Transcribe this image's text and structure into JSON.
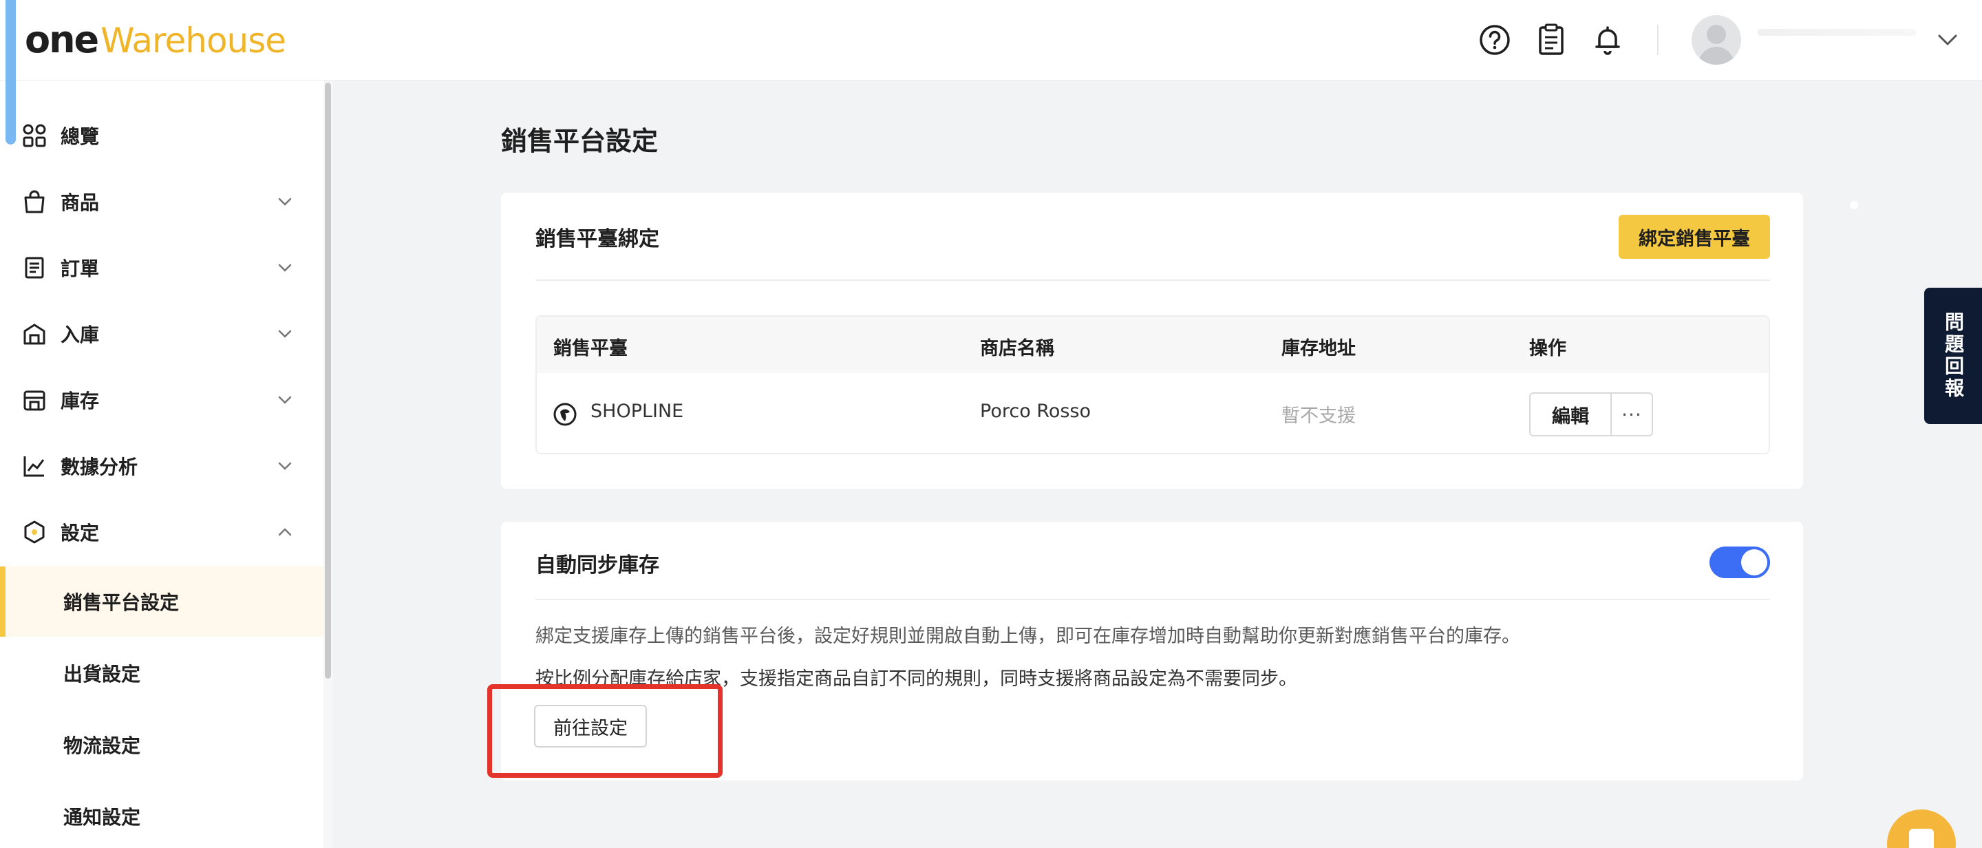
{
  "brand": {
    "logo_one": "one",
    "logo_warehouse": "Warehouse",
    "accent": "#f5c842"
  },
  "header": {
    "icons": [
      "help-circle-icon",
      "clipboard-icon",
      "bell-icon",
      "avatar-icon",
      "chevron-down-icon"
    ]
  },
  "sidebar": {
    "items": [
      {
        "label": "總覽",
        "icon": "dashboard-icon"
      },
      {
        "label": "商品",
        "icon": "shopping-bag-icon"
      },
      {
        "label": "訂單",
        "icon": "receipt-icon"
      },
      {
        "label": "入庫",
        "icon": "inbound-icon"
      },
      {
        "label": "庫存",
        "icon": "warehouse-icon"
      },
      {
        "label": "數據分析",
        "icon": "chart-icon"
      },
      {
        "label": "設定",
        "icon": "settings-hex-icon"
      }
    ],
    "sub_items": [
      {
        "label": "銷售平台設定",
        "active": true
      },
      {
        "label": "出貨設定"
      },
      {
        "label": "物流設定"
      },
      {
        "label": "通知設定"
      }
    ]
  },
  "main": {
    "page_title": "銷售平台設定",
    "binding_card": {
      "title": "銷售平臺綁定",
      "bind_button": "綁定銷售平臺",
      "columns": [
        "銷售平臺",
        "商店名稱",
        "庫存地址",
        "操作"
      ],
      "rows": [
        {
          "platform": "SHOPLINE",
          "store": "Porco Rosso",
          "address": "暫不支援",
          "edit": "編輯",
          "more": "···"
        }
      ]
    },
    "sync_card": {
      "title": "自動同步庫存",
      "toggle_on": true,
      "desc1": "綁定支援庫存上傳的銷售平台後，設定好規則並開啟自動上傳，即可在庫存增加時自動幫助你更新對應銷售平台的庫存。",
      "desc2": "按比例分配庫存給店家，支援指定商品自訂不同的規則，同時支援將商品設定為不需要同步。",
      "goto_button": "前往設定"
    }
  },
  "feedback_tab": "問題回報",
  "colors": {
    "toggle": "#3b6ef5",
    "highlight": "#e3332a",
    "feedback_bg": "#0f1b33"
  }
}
